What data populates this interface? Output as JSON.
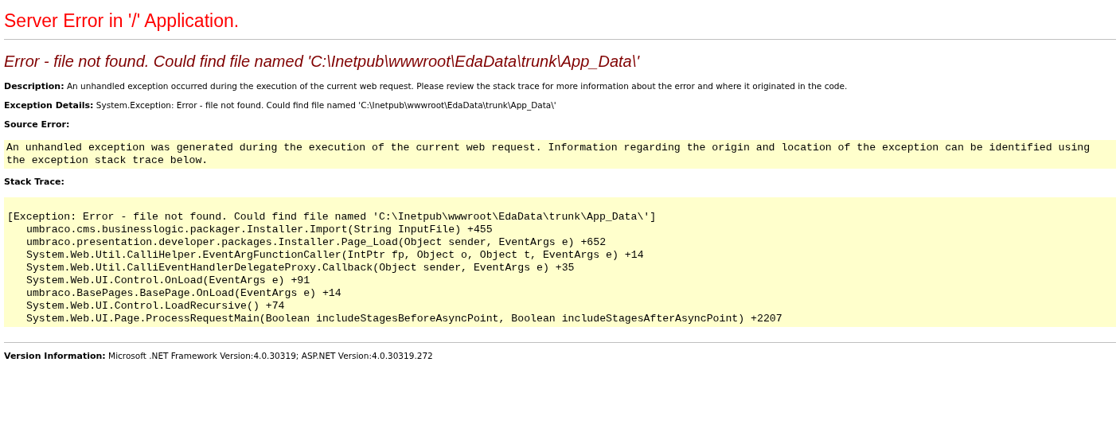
{
  "title": "Server Error in '/' Application.",
  "error_heading": "Error - file not found. Could find file named 'C:\\Inetpub\\wwwroot\\EdaData\\trunk\\App_Data\\'",
  "description": {
    "label": "Description:",
    "text": "An unhandled exception occurred during the execution of the current web request. Please review the stack trace for more information about the error and where it originated in the code."
  },
  "exception_details": {
    "label": "Exception Details:",
    "text": "System.Exception: Error - file not found. Could find file named 'C:\\Inetpub\\wwwroot\\EdaData\\trunk\\App_Data\\'"
  },
  "source_error": {
    "label": "Source Error:",
    "text": "An unhandled exception was generated during the execution of the current web request. Information regarding the origin and location of the exception can be identified using the exception stack trace below."
  },
  "stack_trace": {
    "label": "Stack Trace:",
    "exception": "[Exception: Error - file not found. Could find file named 'C:\\Inetpub\\wwwroot\\EdaData\\trunk\\App_Data\\']",
    "frames": [
      "umbraco.cms.businesslogic.packager.Installer.Import(String InputFile) +455",
      "umbraco.presentation.developer.packages.Installer.Page_Load(Object sender, EventArgs e) +652",
      "System.Web.Util.CalliHelper.EventArgFunctionCaller(IntPtr fp, Object o, Object t, EventArgs e) +14",
      "System.Web.Util.CalliEventHandlerDelegateProxy.Callback(Object sender, EventArgs e) +35",
      "System.Web.UI.Control.OnLoad(EventArgs e) +91",
      "umbraco.BasePages.BasePage.OnLoad(EventArgs e) +14",
      "System.Web.UI.Control.LoadRecursive() +74",
      "System.Web.UI.Page.ProcessRequestMain(Boolean includeStagesBeforeAsyncPoint, Boolean includeStagesAfterAsyncPoint) +2207"
    ]
  },
  "version_information": {
    "label": "Version Information:",
    "text": "Microsoft .NET Framework Version:4.0.30319; ASP.NET Version:4.0.30319.272"
  }
}
